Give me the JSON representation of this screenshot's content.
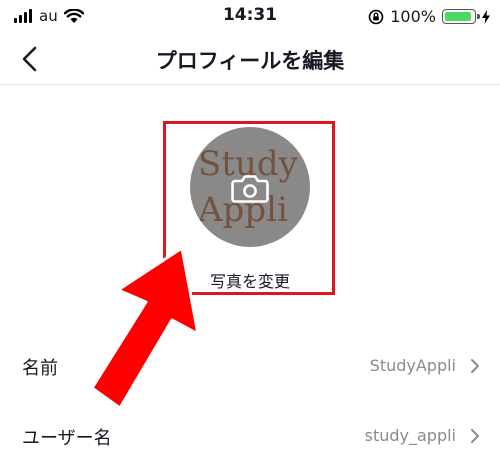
{
  "status_bar": {
    "carrier": "au",
    "time": "14:31",
    "battery_percent": "100%",
    "battery_level": 1.0,
    "colors": {
      "battery_fill": "#4cd964"
    }
  },
  "nav": {
    "back_icon": "chevron-left-icon",
    "title": "プロフィールを編集"
  },
  "avatar": {
    "logo_line1": "Study",
    "logo_line2": "Appli",
    "camera_icon": "camera-icon",
    "change_photo_label": "写真を変更"
  },
  "annotation": {
    "highlight_color": "#e0141e",
    "arrow_color": "#ff0000"
  },
  "fields": [
    {
      "label": "名前",
      "value": "StudyAppli"
    },
    {
      "label": "ユーザー名",
      "value": "study_appli"
    }
  ]
}
